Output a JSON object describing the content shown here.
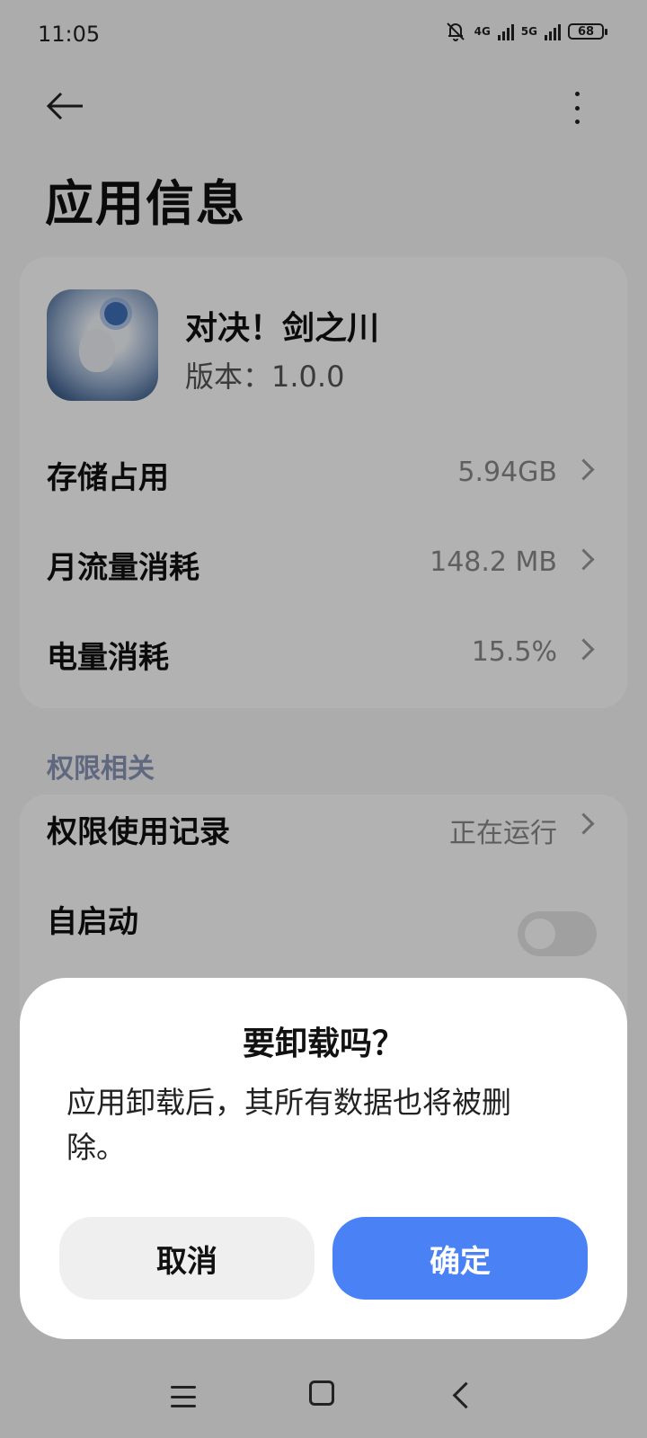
{
  "status_bar": {
    "time": "11:05",
    "net1": "4G",
    "net2": "5G",
    "battery": "68"
  },
  "header": {
    "back_icon": "arrow-left-icon",
    "more_icon": "more-vertical-icon",
    "title": "应用信息"
  },
  "app": {
    "name": "对决！剑之川",
    "version": "版本：1.0.0"
  },
  "usage_rows": [
    {
      "label": "存储占用",
      "value": "5.94GB"
    },
    {
      "label": "月流量消耗",
      "value": "148.2 MB"
    },
    {
      "label": "电量消耗",
      "value": "15.5%"
    }
  ],
  "permissions": {
    "section_title": "权限相关",
    "record_label": "权限使用记录",
    "record_value": "正在运行",
    "autostart_label": "自启动",
    "autostart_on": false
  },
  "dialog": {
    "title": "要卸载吗？",
    "message": "应用卸载后，其所有数据也将被删除。",
    "cancel_label": "取消",
    "confirm_label": "确定",
    "confirm_color": "#4a82f5"
  },
  "nav_bar": {
    "icons": [
      "menu-icon",
      "home-icon",
      "back-icon"
    ]
  }
}
